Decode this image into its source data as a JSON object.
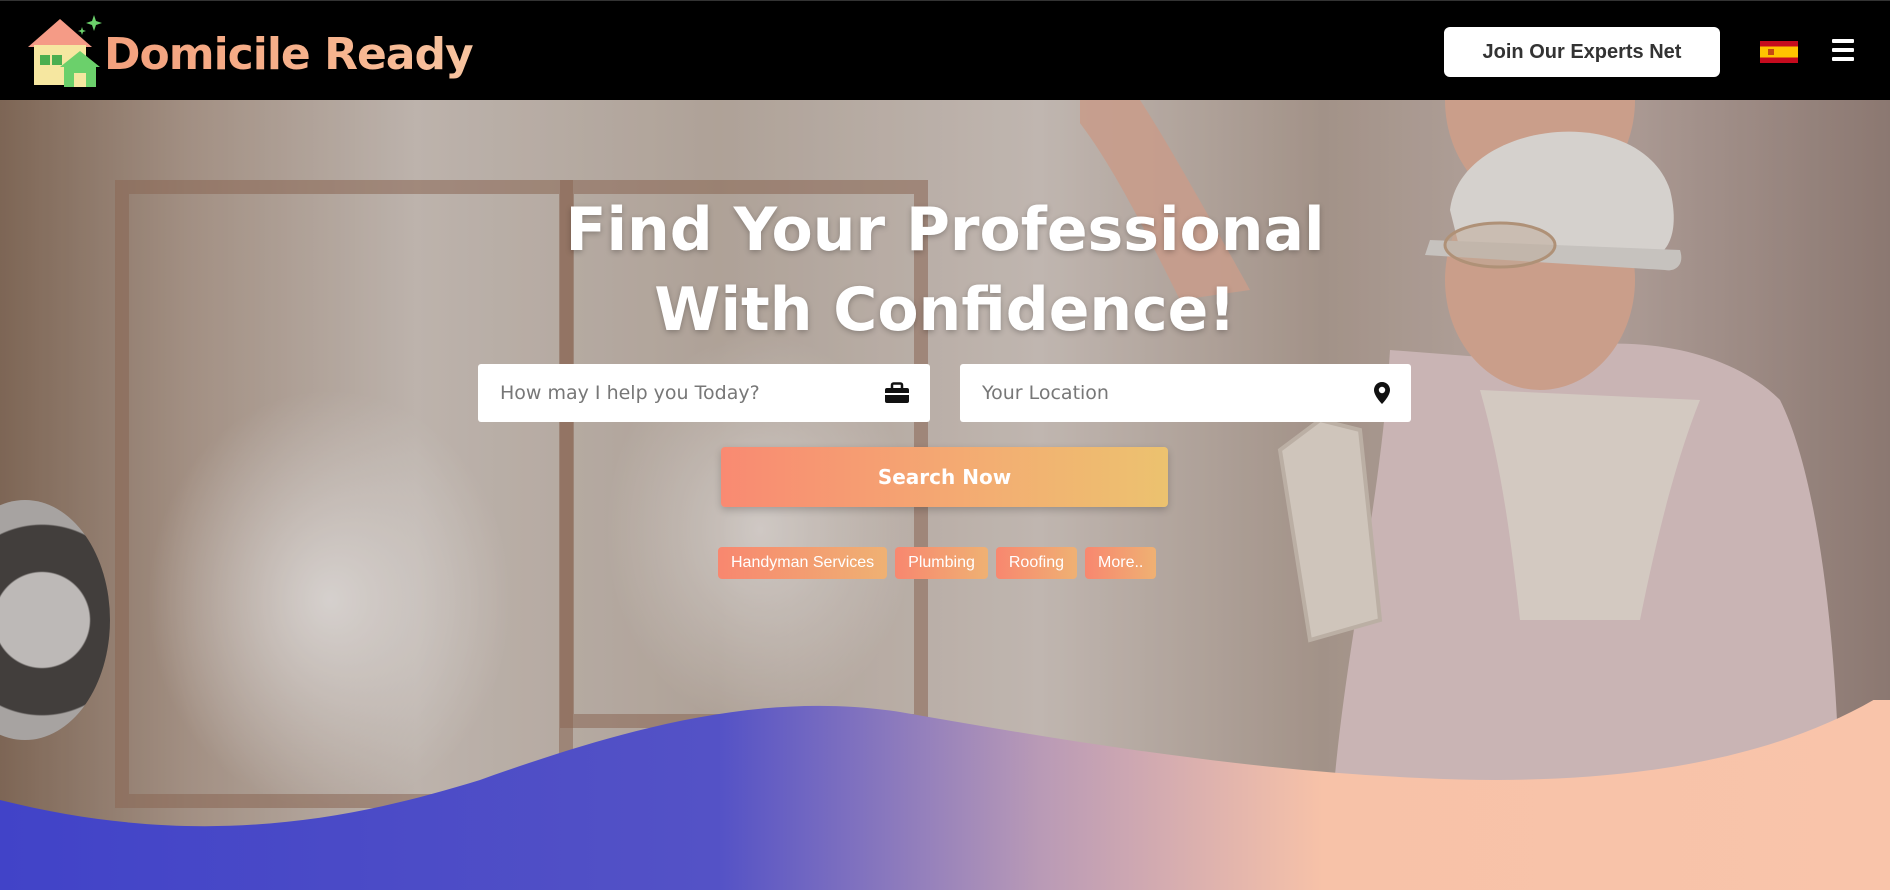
{
  "brand": {
    "name": "Domicile Ready"
  },
  "header": {
    "join_button": "Join Our Experts Net",
    "language_flag": "spain-flag-icon",
    "menu_icon": "hamburger-menu-icon"
  },
  "hero": {
    "headline_line1": "Find Your Professional",
    "headline_line2": "With Confidence!",
    "service_input": {
      "placeholder": "How may I help you Today?",
      "value": "",
      "icon": "briefcase-icon"
    },
    "location_input": {
      "placeholder": "Your Location",
      "value": "",
      "icon": "map-pin-icon"
    },
    "search_button": "Search Now",
    "quick_tags": [
      {
        "label": "Handyman Services"
      },
      {
        "label": "Plumbing"
      },
      {
        "label": "Roofing"
      },
      {
        "label": "More.."
      }
    ]
  },
  "colors": {
    "header_bg": "#000000",
    "accent_start": "#f98a72",
    "accent_end": "#ecc26f",
    "wave_blue": "#4143c8",
    "wave_peach": "#f7c2a8"
  }
}
